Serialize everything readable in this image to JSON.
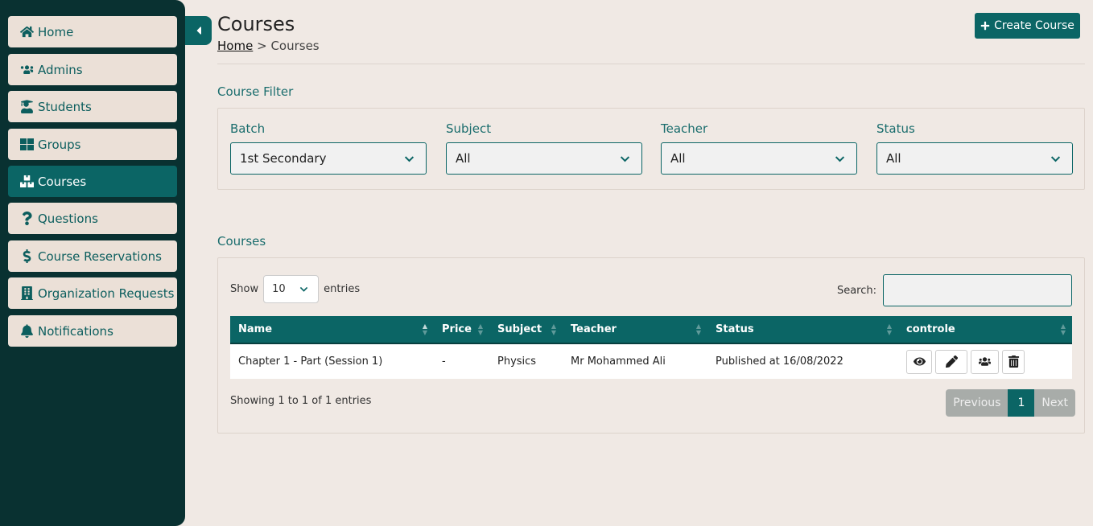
{
  "sidebar": {
    "collapse_icon": "caret-left-icon",
    "items": [
      {
        "label": "Home",
        "icon": "home-icon"
      },
      {
        "label": "Admins",
        "icon": "users-cog-icon"
      },
      {
        "label": "Students",
        "icon": "graduate-icon"
      },
      {
        "label": "Groups",
        "icon": "grid-icon"
      },
      {
        "label": "Courses",
        "icon": "boxes-icon",
        "active": true
      },
      {
        "label": "Questions",
        "icon": "question-icon"
      },
      {
        "label": "Course Reservations",
        "icon": "dollar-icon"
      },
      {
        "label": "Organization Requests",
        "icon": "building-icon"
      },
      {
        "label": "Notifications",
        "icon": "bell-icon"
      }
    ]
  },
  "header": {
    "title": "Courses",
    "breadcrumb_home": "Home",
    "breadcrumb_sep": ">",
    "breadcrumb_current": "Courses",
    "create_label": "Create Course"
  },
  "filter": {
    "heading": "Course Filter",
    "batch": {
      "label": "Batch",
      "value": "1st Secondary"
    },
    "subject": {
      "label": "Subject",
      "value": "All"
    },
    "teacher": {
      "label": "Teacher",
      "value": "All"
    },
    "status": {
      "label": "Status",
      "value": "All"
    }
  },
  "courses": {
    "heading": "Courses",
    "show_label": "Show",
    "entries_value": "10",
    "entries_label": "entries",
    "search_label": "Search:",
    "search_value": "",
    "columns": [
      "Name",
      "Price",
      "Subject",
      "Teacher",
      "Status",
      "controle"
    ],
    "rows": [
      {
        "name": "Chapter 1 - Part (Session 1)",
        "price": "-",
        "subject": "Physics",
        "teacher": "Mr Mohammed Ali",
        "status": "Published at 16/08/2022"
      }
    ],
    "info": "Showing 1 to 1 of 1 entries",
    "pager": {
      "previous": "Previous",
      "current": "1",
      "next": "Next"
    }
  },
  "colors": {
    "sidebar_bg": "#093131",
    "accent": "#0b6565",
    "nav_item_bg": "#ebe0d7",
    "page_bg": "#f0e9e4"
  }
}
